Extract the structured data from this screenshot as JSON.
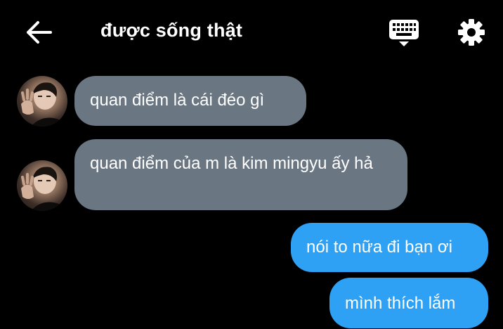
{
  "header": {
    "title": "được sống thật",
    "back_icon": "arrow-left-icon",
    "keyboard_icon": "keyboard-icon",
    "settings_icon": "gear-icon"
  },
  "messages": [
    {
      "side": "incoming",
      "text": "quan điểm là cái đéo gì"
    },
    {
      "side": "incoming",
      "text": "quan điểm của m là kim mingyu ấy hả"
    },
    {
      "side": "outgoing",
      "text": "nói to nữa đi bạn ơi"
    },
    {
      "side": "outgoing",
      "text": "mình thích lắm"
    }
  ],
  "colors": {
    "background": "#000000",
    "incoming_bubble": "#6b7683",
    "outgoing_bubble": "#2ea1f4",
    "text": "#ffffff"
  }
}
